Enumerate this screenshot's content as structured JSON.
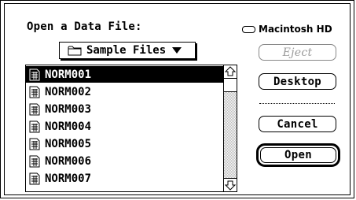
{
  "dialog": {
    "prompt": "Open a Data File:",
    "folder_popup_label": "Sample Files",
    "disk_name": "Macintosh HD"
  },
  "files": [
    {
      "name": "NORM001",
      "selected": true
    },
    {
      "name": "NORM002",
      "selected": false
    },
    {
      "name": "NORM003",
      "selected": false
    },
    {
      "name": "NORM004",
      "selected": false
    },
    {
      "name": "NORM005",
      "selected": false
    },
    {
      "name": "NORM006",
      "selected": false
    },
    {
      "name": "NORM007",
      "selected": false
    }
  ],
  "buttons": {
    "eject": "Eject",
    "desktop": "Desktop",
    "cancel": "Cancel",
    "open": "Open"
  },
  "colors": {
    "selection": "#000000",
    "disabled_text": "#9a9a9a"
  }
}
